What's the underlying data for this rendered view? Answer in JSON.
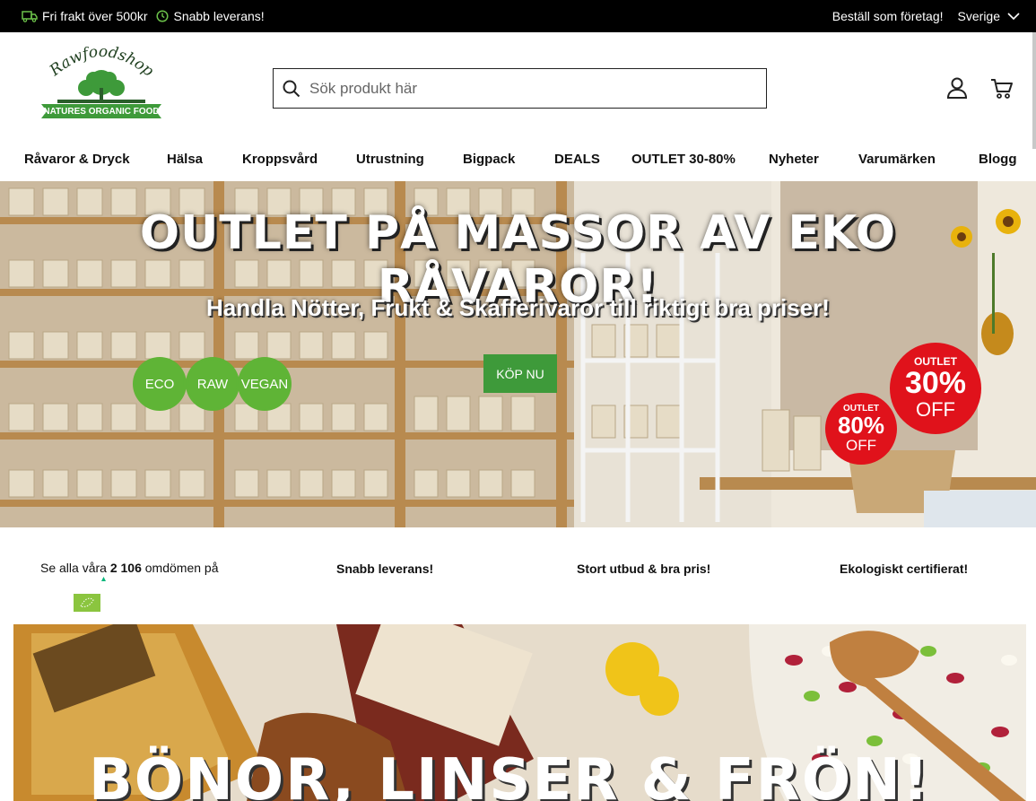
{
  "topbar": {
    "free_shipping": "Fri frakt över 500kr",
    "fast_delivery": "Snabb leverans!",
    "business_link": "Beställ som företag!",
    "country": "Sverige"
  },
  "logo": {
    "wordmark": "Rawfoodshop",
    "tagline": "NATURES ORGANIC FOOD"
  },
  "search": {
    "placeholder": "Sök produkt här",
    "value": ""
  },
  "nav": {
    "items": [
      "Råvaror & Dryck",
      "Hälsa",
      "Kroppsvård",
      "Utrustning",
      "Bigpack",
      "DEALS",
      "OUTLET 30-80%",
      "Nyheter",
      "Varumärken",
      "Blogg"
    ]
  },
  "hero": {
    "headline": "OUTLET PÅ MASSOR AV EKO RÅVAROR!",
    "subheadline": "Handla Nötter, Frukt & Skafferivaror till riktigt bra priser!",
    "cta": "KÖP NU",
    "badges": [
      "ECO",
      "RAW",
      "VEGAN"
    ],
    "sale_big": {
      "top": "OUTLET",
      "pct": "30%",
      "off": "OFF"
    },
    "sale_small": {
      "top": "OUTLET",
      "pct": "80%",
      "off": "OFF"
    }
  },
  "usp": {
    "reviews_prefix": "Se alla våra",
    "reviews_count": "2 106",
    "reviews_suffix": "omdömen på",
    "items": [
      "Snabb leverans!",
      "Stort utbud & bra pris!",
      "Ekologiskt certifierat!"
    ]
  },
  "banner2": {
    "title": "BÖNOR, LINSER & FRÖN!"
  },
  "colors": {
    "accent": "#3e9a3a",
    "sale": "#e0121b",
    "topbar": "#000000"
  }
}
